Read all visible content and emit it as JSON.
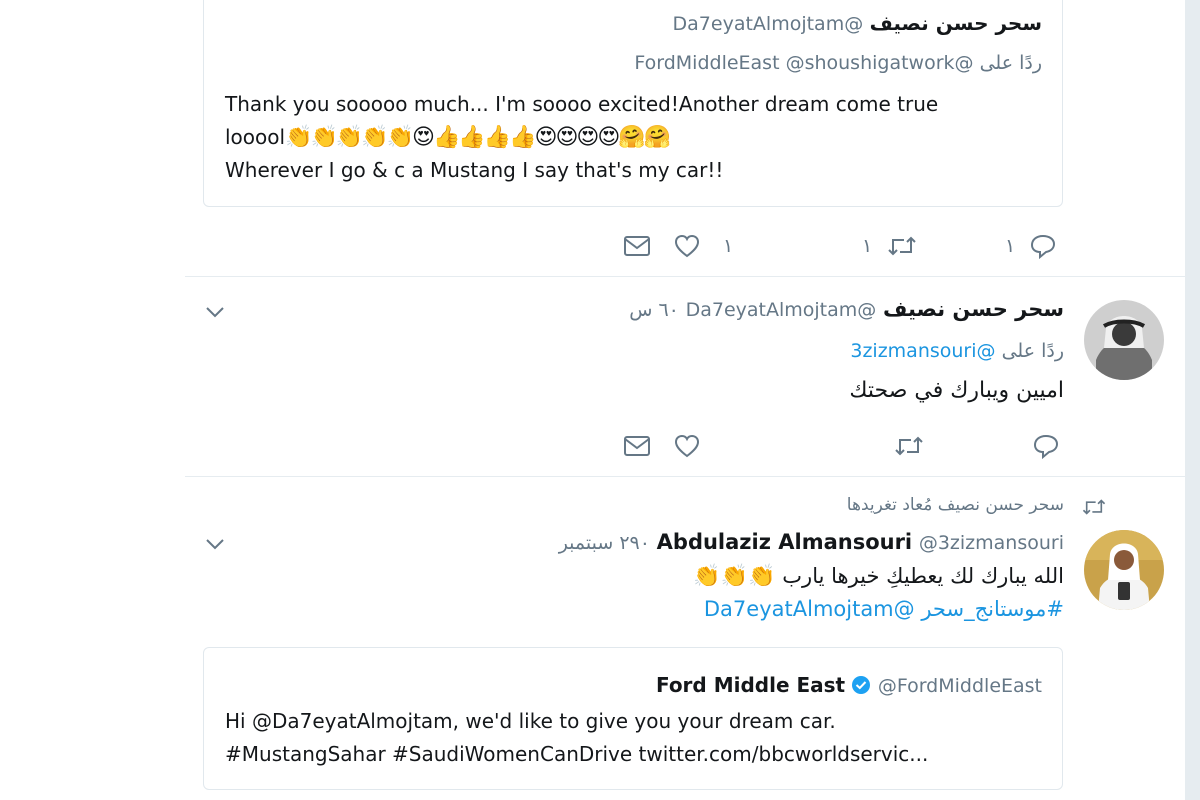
{
  "tweet1": {
    "quote": {
      "name": "سحر حسن نصيف",
      "handle": "@Da7eyatAlmojtam",
      "reply_to_label": "ردًا على",
      "reply_to": "@FordMiddleEast @shoushigatwork",
      "text_line1": "Thank you sooooo much... I'm soooo excited!Another dream come true",
      "text_line2_prefix": "looool",
      "text_line2_emoji": "👏👏👏👏👏😍👍👍👍👍😍😍😍😍🤗🤗",
      "text_line3": "Wherever I go & c a Mustang I say that's my car!!"
    },
    "actions": {
      "reply_count": "١",
      "retweet_count": "١",
      "like_count": "١"
    }
  },
  "tweet2": {
    "name": "سحر حسن نصيف",
    "handle": "@Da7eyatAlmojtam",
    "time": "٦٠ س",
    "reply_to_label": "ردًا على",
    "reply_to": "@3zizmansouri",
    "text": "اميين ويبارك في صحتك"
  },
  "tweet3": {
    "retweeted_by": "سحر حسن نصيف مُعاد تغريدها",
    "name": "Abdulaziz Almansouri",
    "handle": "@3zizmansouri",
    "time": "٢٩٠ سبتمبر",
    "text": "الله يبارك لك يعطيكِ خيرها يارب",
    "text_emoji": "👏👏👏",
    "hashtag": "#موستانج_سحر",
    "mention": "@Da7eyatAlmojtam",
    "quote": {
      "name": "Ford Middle East",
      "handle": "@FordMiddleEast",
      "text_line1": "Hi @Da7eyatAlmojtam, we'd like to give you your dream car.",
      "text_line2": "#MustangSahar #SaudiWomenCanDrive twitter.com/bbcworldservic..."
    }
  }
}
